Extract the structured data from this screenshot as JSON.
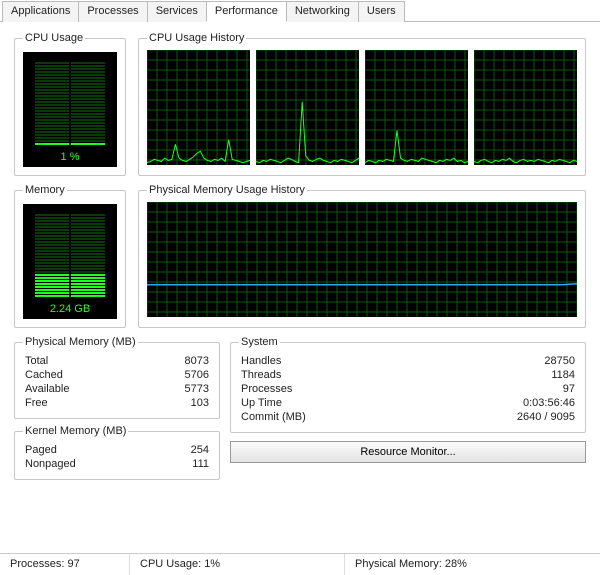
{
  "tabs": [
    "Applications",
    "Processes",
    "Services",
    "Performance",
    "Networking",
    "Users"
  ],
  "active_tab": 3,
  "cpu": {
    "title": "CPU Usage",
    "value_label": "1 %",
    "history_title": "CPU Usage History"
  },
  "memory": {
    "title": "Memory",
    "value_label": "2.24 GB",
    "history_title": "Physical Memory Usage History"
  },
  "phys_mem": {
    "legend": "Physical Memory (MB)",
    "total_k": "Total",
    "total_v": "8073",
    "cached_k": "Cached",
    "cached_v": "5706",
    "avail_k": "Available",
    "avail_v": "5773",
    "free_k": "Free",
    "free_v": "103"
  },
  "kernel": {
    "legend": "Kernel Memory (MB)",
    "paged_k": "Paged",
    "paged_v": "254",
    "nonpaged_k": "Nonpaged",
    "nonpaged_v": "111"
  },
  "system": {
    "legend": "System",
    "handles_k": "Handles",
    "handles_v": "28750",
    "threads_k": "Threads",
    "threads_v": "1184",
    "processes_k": "Processes",
    "processes_v": "97",
    "uptime_k": "Up Time",
    "uptime_v": "0:03:56:46",
    "commit_k": "Commit (MB)",
    "commit_v": "2640 / 9095"
  },
  "resource_button": "Resource Monitor...",
  "status": {
    "processes": "Processes: 97",
    "cpu": "CPU Usage: 1%",
    "mem": "Physical Memory: 28%"
  },
  "chart_data": [
    {
      "type": "line",
      "title": "CPU Usage History (core 1)",
      "ylim": [
        0,
        100
      ],
      "values": [
        2,
        3,
        5,
        4,
        3,
        6,
        4,
        5,
        18,
        6,
        4,
        3,
        5,
        7,
        10,
        12,
        6,
        4,
        3,
        5,
        4,
        6,
        3,
        22,
        5,
        4,
        3,
        2,
        3,
        4
      ]
    },
    {
      "type": "line",
      "title": "CPU Usage History (core 2)",
      "ylim": [
        0,
        100
      ],
      "values": [
        3,
        2,
        4,
        3,
        5,
        4,
        3,
        2,
        4,
        6,
        5,
        3,
        2,
        55,
        8,
        4,
        3,
        5,
        6,
        4,
        3,
        2,
        4,
        3,
        5,
        4,
        3,
        2,
        4,
        6
      ]
    },
    {
      "type": "line",
      "title": "CPU Usage History (core 3)",
      "ylim": [
        0,
        100
      ],
      "values": [
        2,
        4,
        3,
        2,
        4,
        3,
        5,
        4,
        3,
        30,
        6,
        4,
        3,
        5,
        4,
        3,
        6,
        5,
        4,
        3,
        2,
        4,
        3,
        5,
        4,
        6,
        3,
        4,
        2,
        3
      ]
    },
    {
      "type": "line",
      "title": "CPU Usage History (core 4)",
      "ylim": [
        0,
        100
      ],
      "values": [
        3,
        2,
        4,
        5,
        3,
        2,
        4,
        3,
        5,
        4,
        6,
        3,
        2,
        4,
        5,
        3,
        4,
        3,
        5,
        4,
        3,
        2,
        4,
        3,
        5,
        4,
        3,
        2,
        4,
        3
      ]
    },
    {
      "type": "line",
      "title": "Physical Memory Usage History",
      "ylim": [
        0,
        100
      ],
      "values": [
        28,
        28,
        28,
        28,
        28,
        28,
        28,
        28,
        28,
        28,
        28,
        28,
        28,
        28,
        28,
        28,
        28,
        28,
        28,
        28,
        28,
        28,
        28,
        28,
        28,
        28,
        28,
        28,
        28,
        29
      ]
    }
  ]
}
